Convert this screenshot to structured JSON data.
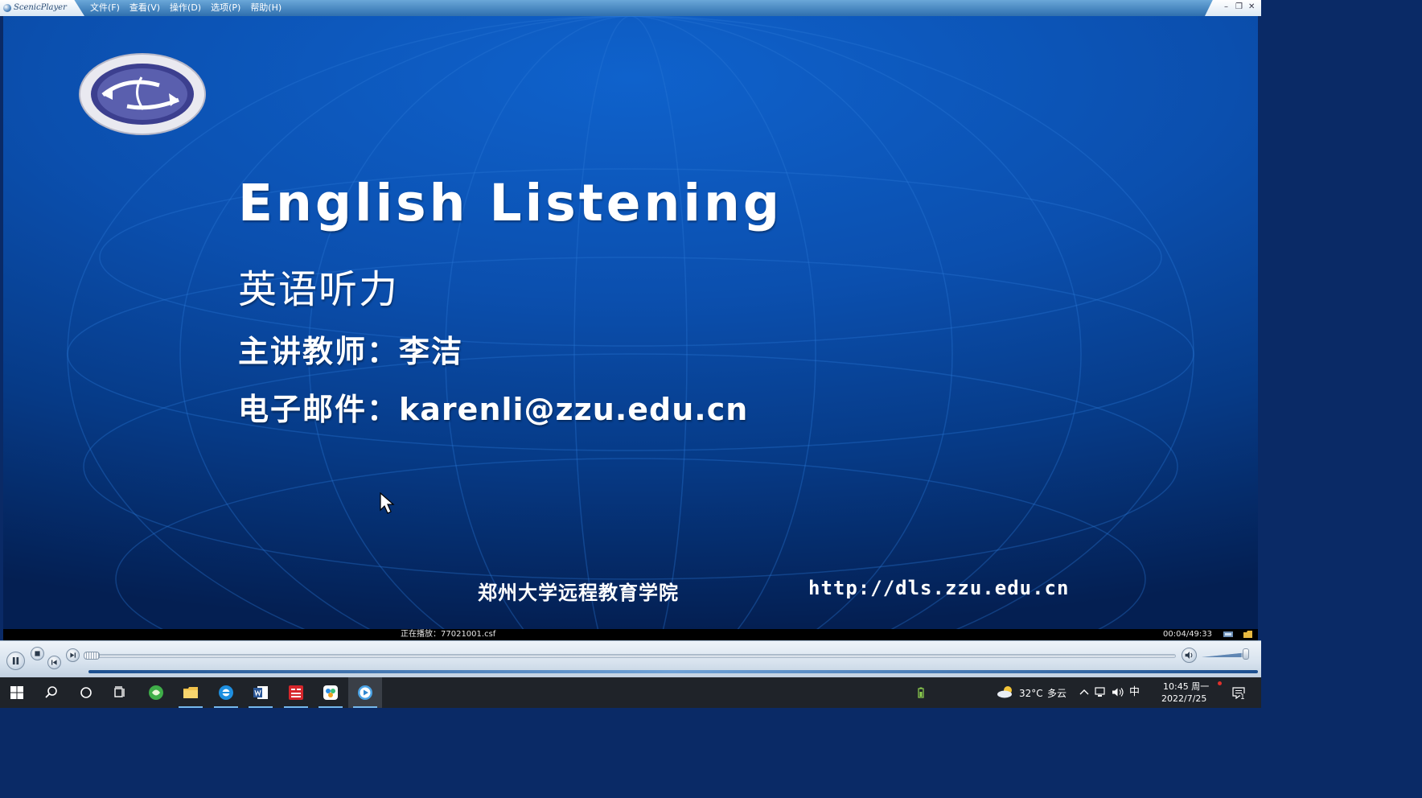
{
  "window": {
    "app_name": "ScenicPlayer",
    "menu": [
      "文件(F)",
      "查看(V)",
      "操作(D)",
      "选项(P)",
      "帮助(H)"
    ],
    "controls": {
      "minimize": "–",
      "restore": "❐",
      "close": "✕"
    }
  },
  "slide": {
    "title": "English Listening",
    "subtitle": "英语听力",
    "lecturer_label": "主讲教师：",
    "lecturer_name": "李洁",
    "email_label": "电子邮件：",
    "email_value": "karenli@zzu.edu.cn",
    "institution": "郑州大学远程教育学院",
    "website": "http://dls.zzu.edu.cn"
  },
  "player": {
    "now_playing": "正在播放：77021001.csf",
    "time": "00:04/49:33",
    "progress": 0.0,
    "volume": 0.85
  },
  "taskbar": {
    "weather_temp": "32°C",
    "weather_desc": "多云",
    "ime": "中",
    "clock_time": "10:45 周一",
    "clock_date": "2022/7/25",
    "notification_count": "1",
    "icons": [
      "windows-start-icon",
      "search-icon",
      "cortana-icon",
      "task-view-icon",
      "browser-green-icon",
      "file-explorer-icon",
      "browser-blue-icon",
      "word-icon",
      "news-app-icon",
      "cloud-app-icon",
      "media-player-icon"
    ]
  }
}
